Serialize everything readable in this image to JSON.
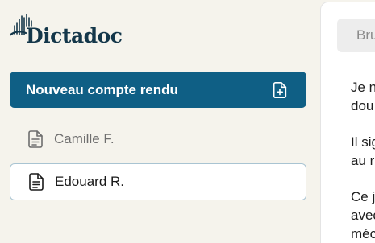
{
  "app": {
    "logo_text": "Dictadoc"
  },
  "sidebar": {
    "new_button_label": "Nouveau compte rendu",
    "new_button_icon": "file-plus-icon",
    "items": [
      {
        "label": "Camille F.",
        "icon": "document-icon",
        "selected": false
      },
      {
        "label": "Edouard R.",
        "icon": "document-icon",
        "selected": true
      }
    ]
  },
  "panel": {
    "tab_label": "Bru",
    "text_fragments": [
      "Je n",
      "dou",
      "Il sig",
      "au r",
      "Ce j",
      "avec",
      "méc"
    ]
  },
  "colors": {
    "background": "#f5f3ec",
    "primary": "#0f5f85",
    "logo": "#14374a",
    "selected_border": "#a9c4d2",
    "panel": "#ffffff"
  }
}
